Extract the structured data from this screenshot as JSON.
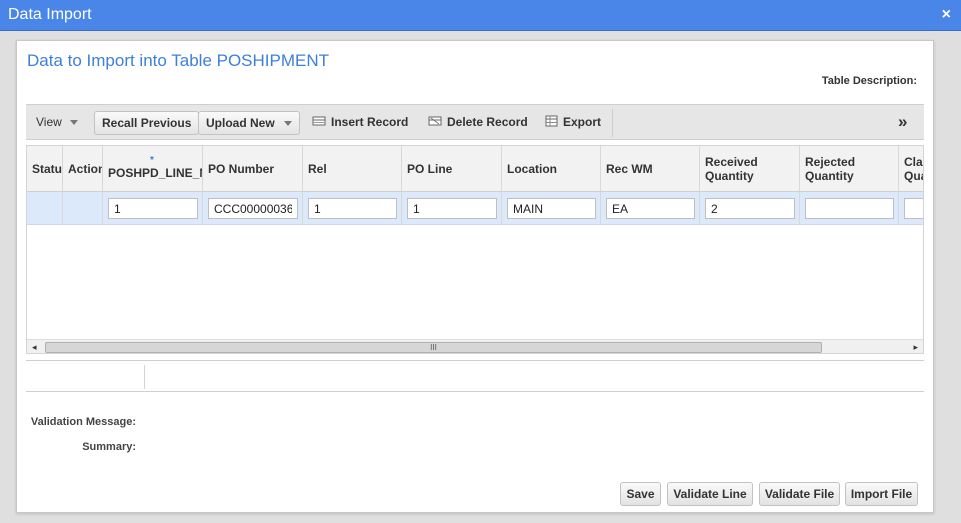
{
  "window": {
    "title": "Data Import",
    "close_glyph": "×"
  },
  "panel": {
    "heading": "Data to Import into Table POSHIPMENT",
    "table_description_label": "Table Description:"
  },
  "toolbar": {
    "view": "View",
    "recall_previous": "Recall Previous",
    "upload_new": "Upload New",
    "insert_record": "Insert Record",
    "delete_record": "Delete Record",
    "export": "Export",
    "overflow": "»"
  },
  "grid": {
    "columns": [
      "Status",
      "Action",
      "POSHPD_LINE_NUI",
      "PO Number",
      "Rel",
      "PO Line",
      "Location",
      "Rec WM",
      "Received Quantity",
      "Rejected Quantity",
      "Clai Qua"
    ],
    "required_marker": "*",
    "row": {
      "poshpd_line_num": "1",
      "po_number": "CCC00000036",
      "rel": "1",
      "po_line": "1",
      "location": "MAIN",
      "rec_wm": "EA",
      "received_quantity": "2",
      "rejected_quantity": "",
      "claim_quantity": ""
    },
    "scroll_grip": "III",
    "scroll_left": "◂",
    "scroll_right": "▸"
  },
  "labels": {
    "validation_message": "Validation Message:",
    "summary": "Summary:"
  },
  "buttons": {
    "save": "Save",
    "validate_line": "Validate Line",
    "validate_file": "Validate File",
    "import_file": "Import File"
  },
  "colors": {
    "titlebar": "#4a86e8",
    "heading": "#3d7fd9",
    "row_selected": "#dbe9fb"
  }
}
